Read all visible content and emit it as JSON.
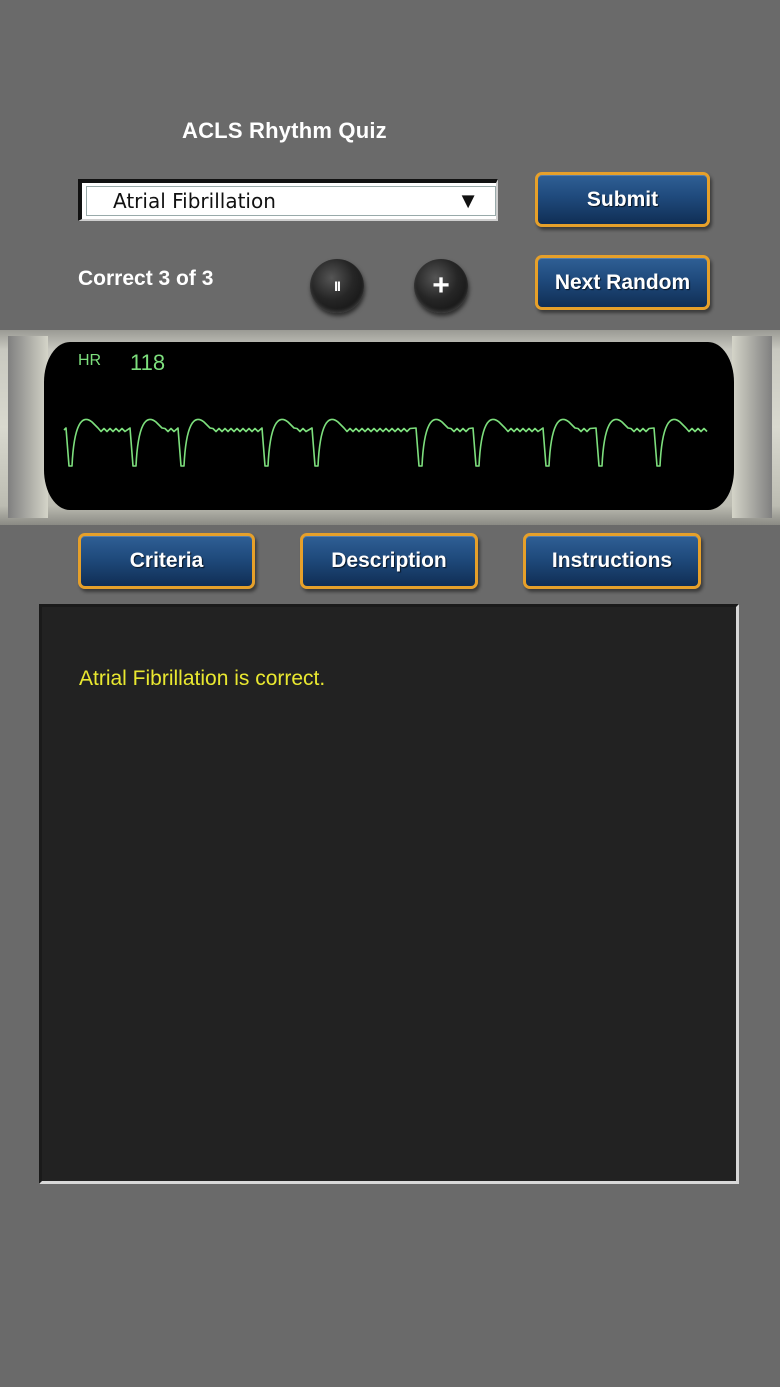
{
  "header": {
    "title": "ACLS Rhythm Quiz"
  },
  "rhythm_select": {
    "selected": "Atrial Fibrillation",
    "arrow": "▼"
  },
  "buttons": {
    "submit": "Submit",
    "next_random": "Next Random",
    "criteria": "Criteria",
    "description": "Description",
    "instructions": "Instructions",
    "pause_glyph": "II",
    "add_glyph": "+"
  },
  "score": {
    "text": "Correct 3 of 3",
    "correct": 3,
    "total": 3
  },
  "monitor": {
    "hr_label": "HR",
    "hr_value": "118",
    "trace_color": "#7ddf7d",
    "waveform": "Atrial Fibrillation"
  },
  "result": {
    "message": "Atrial Fibrillation is correct.",
    "color": "#e9e830"
  },
  "colors": {
    "background": "#6a6a6a",
    "button_border": "#e6a02a",
    "button_fill": "#1f4a7c"
  }
}
